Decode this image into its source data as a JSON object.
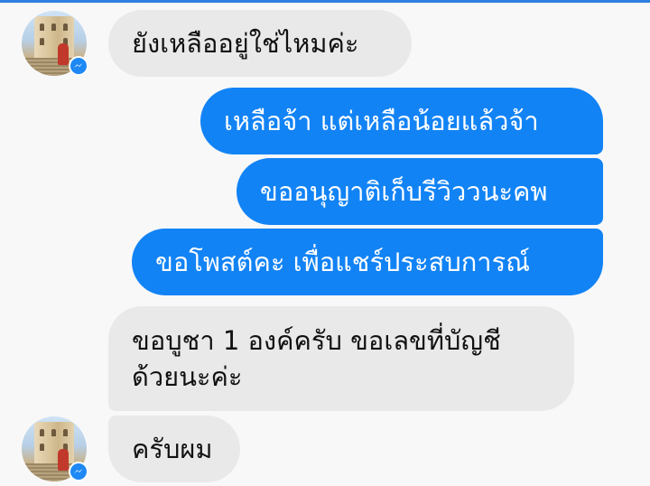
{
  "messages": [
    {
      "direction": "incoming",
      "text": "ยังเหลืออยู่ใช่ไหมค่ะ"
    },
    {
      "direction": "outgoing",
      "text": "เหลือจ้า  แต่เหลือน้อยแล้วจ้า"
    },
    {
      "direction": "outgoing",
      "text": "ขออนุญาติเก็บรีวิววนะคพ"
    },
    {
      "direction": "outgoing",
      "text": "ขอโพสต์คะ  เพื่อแชร์ประสบการณ์"
    },
    {
      "direction": "incoming",
      "text": "ขอบูชา 1 องค์ครับ ขอเลขที่บัญชี ด้วยนะค่ะ"
    },
    {
      "direction": "incoming",
      "text": "ครับผม"
    }
  ],
  "colors": {
    "outgoing_bubble": "#1283f5",
    "incoming_bubble": "#e9e9e9",
    "background": "#f8f8f8",
    "messenger_badge": "#1e88f5"
  },
  "icons": {
    "badge": "messenger-icon",
    "avatar": "user-avatar"
  }
}
